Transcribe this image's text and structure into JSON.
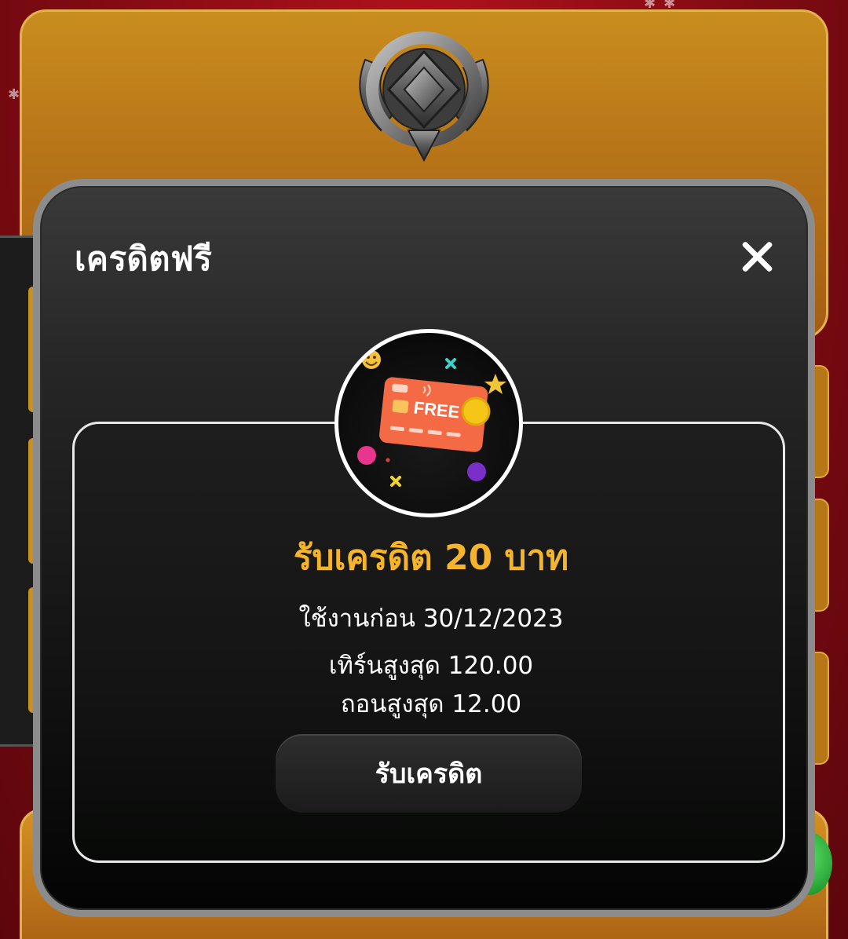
{
  "modal": {
    "title": "เครดิตฟรี",
    "close_icon": "close-icon"
  },
  "reward": {
    "icon": "free-credit-card-icon",
    "card_text": "FREE",
    "headline": "รับเครดิต 20 บาท",
    "expiry": "ใช้งานก่อน 30/12/2023",
    "max_turnover": "เทิร์นสูงสุด 120.00",
    "max_withdraw": "ถอนสูงสุด 12.00",
    "claim_label": "รับเครดิต"
  },
  "background": {
    "badge_icon": "rank-badge-icon"
  },
  "colors": {
    "accent": "#f5b429",
    "modal_border": "#8c8c8c",
    "card": "#f46a45"
  }
}
